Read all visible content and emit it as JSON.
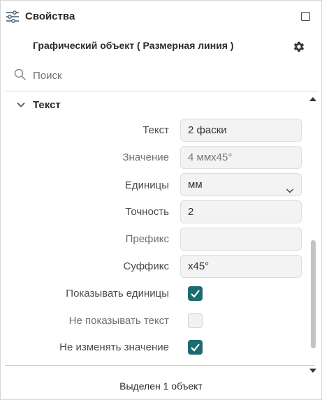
{
  "header": {
    "title": "Свойства",
    "icon": "sliders-icon",
    "window_button_icon": "square-icon"
  },
  "object": {
    "title": "Графический объект ( Размерная линия )",
    "settings_icon": "gear-icon"
  },
  "search": {
    "placeholder": "Поиск",
    "value": ""
  },
  "section": {
    "title": "Текст",
    "expanded": true
  },
  "fields": {
    "text": {
      "label": "Текст",
      "value": "2 фаски"
    },
    "value": {
      "label": "Значение",
      "value": "4 ммх45°"
    },
    "units": {
      "label": "Единицы",
      "value": "мм"
    },
    "precision": {
      "label": "Точность",
      "value": "2"
    },
    "prefix": {
      "label": "Префикс",
      "value": ""
    },
    "suffix": {
      "label": "Суффикс",
      "value": "х45°"
    }
  },
  "checkboxes": {
    "show_units": {
      "label": "Показывать единицы",
      "checked": true
    },
    "hide_text": {
      "label": "Не показывать текст",
      "checked": false
    },
    "lock_value": {
      "label": "Не изменять значение",
      "checked": true
    }
  },
  "status": {
    "text": "Выделен 1 объект"
  },
  "colors": {
    "accent": "#1b6b72",
    "field_bg": "#f3f3f3"
  }
}
